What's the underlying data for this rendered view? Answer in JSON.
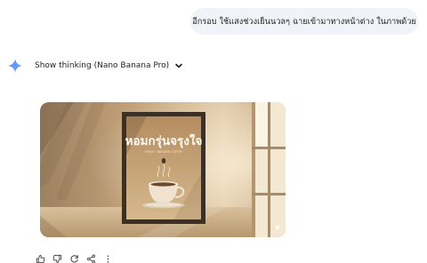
{
  "conversation": {
    "user_message": "อีกรอบ ใช้แสงช่วงเย็นนวลๆ ฉายเข้ามาทางหน้าต่าง ในภาพด้วย"
  },
  "response": {
    "thinking_toggle_label": "Show thinking (Nano Banana Pro)",
    "image": {
      "poster_title": "หอมกรุ่นจรุงใจ",
      "poster_subtitle": "FRESH · BROWED COFFEE"
    },
    "actions": [
      "thumbs-up-icon",
      "thumbs-down-icon",
      "regenerate-icon",
      "share-icon",
      "more-vert-icon"
    ]
  },
  "colors": {
    "accent": "#4285f4",
    "user_bubble": "#f0f4f9",
    "wall": "#c9ab82",
    "poster_bg": "#c7a070",
    "frame": "#3b3026"
  }
}
